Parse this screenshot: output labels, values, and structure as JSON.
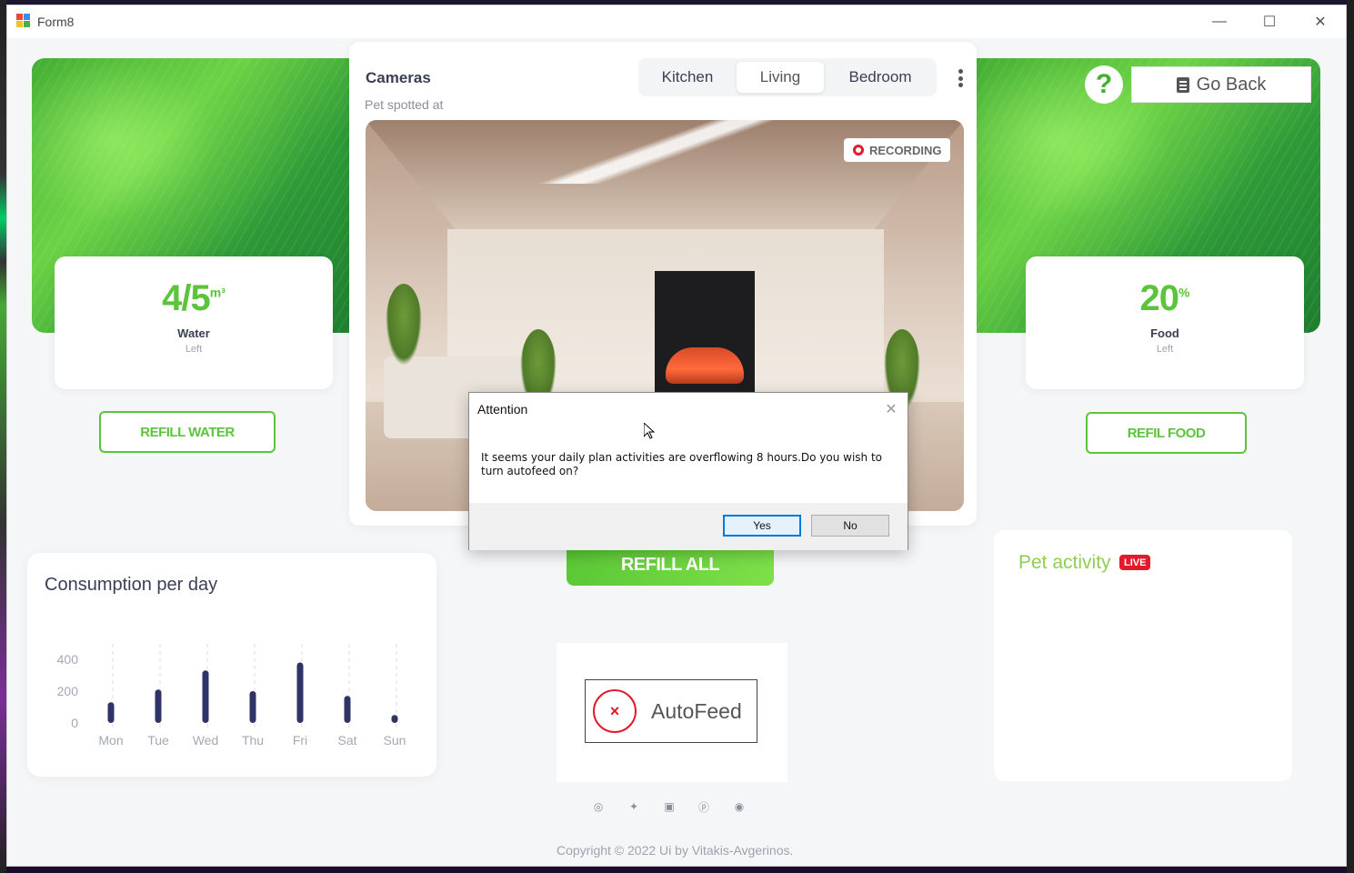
{
  "window": {
    "title": "Form8",
    "minimize_glyph": "—",
    "maximize_glyph": "☐",
    "close_glyph": "✕"
  },
  "header": {
    "help_glyph": "?",
    "go_back_label": "Go Back"
  },
  "water": {
    "value": "4/5",
    "unit": "m³",
    "label": "Water",
    "sub": "Left",
    "button": "REFILL WATER"
  },
  "food": {
    "value": "20",
    "unit": "%",
    "label": "Food",
    "sub": "Left",
    "button": "REFIL FOOD"
  },
  "cameras": {
    "title": "Cameras",
    "subtitle": "Pet spotted at",
    "tabs": [
      {
        "label": "Kitchen",
        "active": false
      },
      {
        "label": "Living",
        "active": true
      },
      {
        "label": "Bedroom",
        "active": false
      }
    ],
    "recording_label": "RECORDING"
  },
  "refill_all": "REFILL ALL",
  "consumption": {
    "title": "Consumption per day"
  },
  "chart_data": {
    "type": "bar",
    "title": "Consumption per day",
    "categories": [
      "Mon",
      "Tue",
      "Wed",
      "Thu",
      "Fri",
      "Sat",
      "Sun"
    ],
    "values": [
      130,
      210,
      330,
      200,
      380,
      170,
      50
    ],
    "yticks": [
      0,
      200,
      400
    ],
    "ylim": [
      0,
      400
    ],
    "bar_color": "#2e3566",
    "grid": "vertical-dashed"
  },
  "autofeed": {
    "label": "AutoFeed",
    "status_glyph": "×"
  },
  "pet_activity": {
    "title": "Pet activity",
    "live_label": "LIVE"
  },
  "footer": {
    "social_icons": [
      "dribbble-icon",
      "twitter-icon",
      "instagram-icon",
      "pinterest-icon",
      "github-icon"
    ],
    "copyright": "Copyright © 2022 Ui by Vitakis-Avgerinos."
  },
  "dialog": {
    "title": "Attention",
    "message": "It seems your daily plan activities are overflowing 8 hours.Do you wish to turn autofeed on?",
    "yes_label": "Yes",
    "no_label": "No"
  },
  "colors": {
    "accent_green": "#5cc43a",
    "danger_red": "#e21b2a",
    "text_dark": "#3a3f55"
  }
}
